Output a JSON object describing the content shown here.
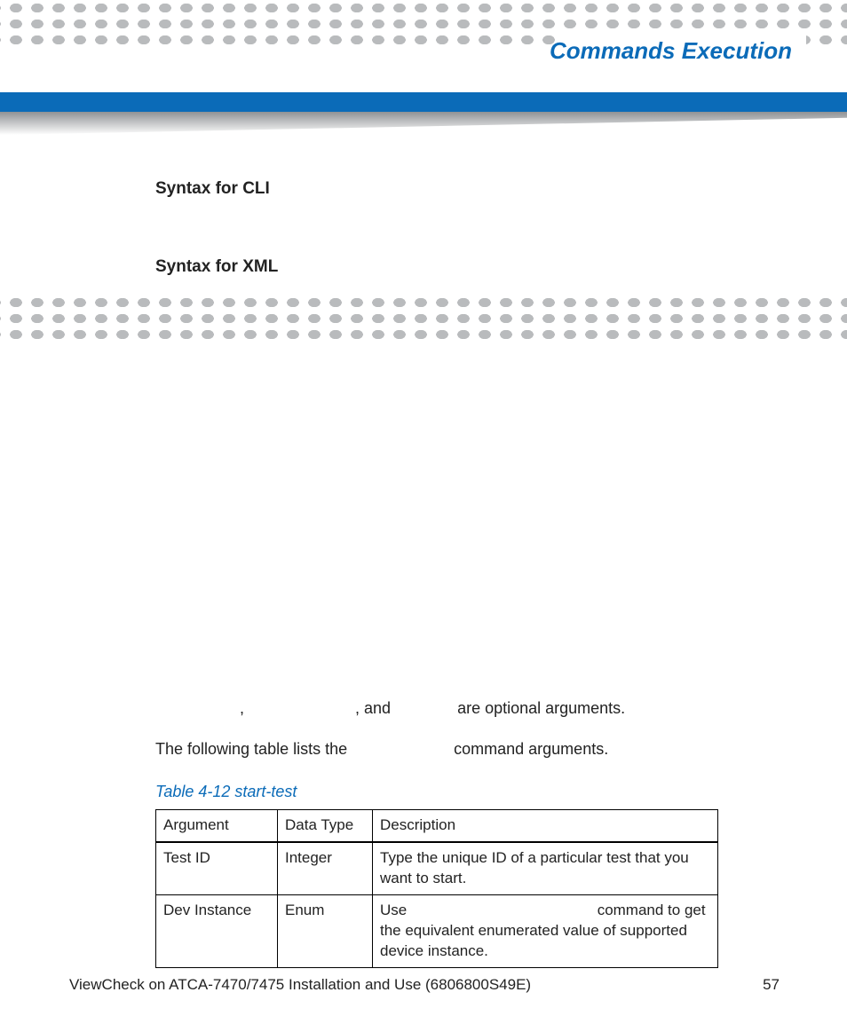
{
  "header": {
    "title": "Commands Execution"
  },
  "sections": {
    "cli_heading": "Syntax for CLI",
    "xml_heading": "Syntax for XML",
    "optional_line_prefix": "",
    "optional_line_sep1": ", ",
    "optional_line_sep2": ", and ",
    "optional_line_suffix": "are optional arguments.",
    "table_intro_prefix": "The following table lists the ",
    "table_intro_suffix": " command arguments."
  },
  "table": {
    "caption": "Table 4-12 start-test",
    "headers": {
      "arg": "Argument",
      "type": "Data Type",
      "desc": "Description"
    },
    "rows": [
      {
        "arg": "Test ID",
        "type": "Integer",
        "desc": "Type the unique ID of a particular test that you want to start."
      },
      {
        "arg": "Dev Instance",
        "type": "Enum",
        "desc_pre": "Use ",
        "desc_post": " command to get the equivalent enumerated value of supported device instance."
      }
    ]
  },
  "footer": {
    "doc": "ViewCheck on ATCA-7470/7475 Installation and Use (6806800S49E)",
    "page": "57"
  }
}
